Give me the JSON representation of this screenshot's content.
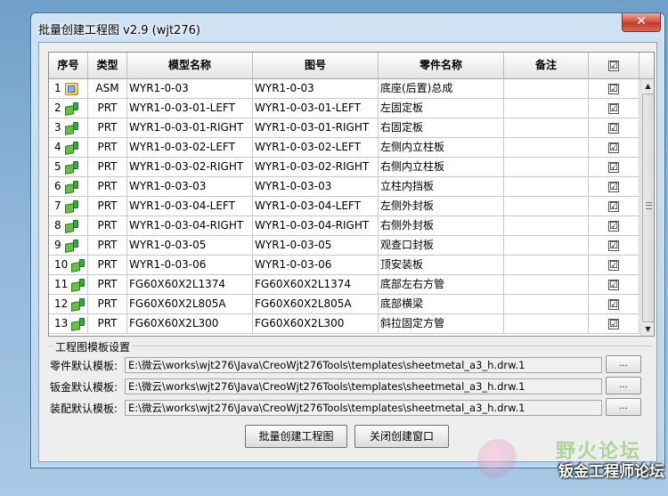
{
  "window": {
    "title": "批量创建工程图 v2.9 (wjt276)",
    "close_glyph": "✕"
  },
  "table": {
    "headers": [
      "序号",
      "类型",
      "模型名称",
      "图号",
      "零件名称",
      "备注",
      "☑"
    ],
    "rows": [
      {
        "no": "1",
        "type": "ASM",
        "icon": "assembly-icon",
        "model": "WYR1-0-03",
        "drawing": "WYR1-0-03",
        "part": "底座(后置)总成",
        "note": "",
        "checked": "☑"
      },
      {
        "no": "2",
        "type": "PRT",
        "icon": "part-icon",
        "model": "WYR1-0-03-01-LEFT",
        "drawing": "WYR1-0-03-01-LEFT",
        "part": "左固定板",
        "note": "",
        "checked": "☑"
      },
      {
        "no": "3",
        "type": "PRT",
        "icon": "part-icon",
        "model": "WYR1-0-03-01-RIGHT",
        "drawing": "WYR1-0-03-01-RIGHT",
        "part": "右固定板",
        "note": "",
        "checked": "☑"
      },
      {
        "no": "4",
        "type": "PRT",
        "icon": "part-icon",
        "model": "WYR1-0-03-02-LEFT",
        "drawing": "WYR1-0-03-02-LEFT",
        "part": "左侧内立柱板",
        "note": "",
        "checked": "☑"
      },
      {
        "no": "5",
        "type": "PRT",
        "icon": "part-icon",
        "model": "WYR1-0-03-02-RIGHT",
        "drawing": "WYR1-0-03-02-RIGHT",
        "part": "右侧内立柱板",
        "note": "",
        "checked": "☑"
      },
      {
        "no": "6",
        "type": "PRT",
        "icon": "part-icon",
        "model": "WYR1-0-03-03",
        "drawing": "WYR1-0-03-03",
        "part": "立柱内挡板",
        "note": "",
        "checked": "☑"
      },
      {
        "no": "7",
        "type": "PRT",
        "icon": "part-icon",
        "model": "WYR1-0-03-04-LEFT",
        "drawing": "WYR1-0-03-04-LEFT",
        "part": "左侧外封板",
        "note": "",
        "checked": "☑"
      },
      {
        "no": "8",
        "type": "PRT",
        "icon": "part-icon",
        "model": "WYR1-0-03-04-RIGHT",
        "drawing": "WYR1-0-03-04-RIGHT",
        "part": "右侧外封板",
        "note": "",
        "checked": "☑"
      },
      {
        "no": "9",
        "type": "PRT",
        "icon": "part-icon",
        "model": "WYR1-0-03-05",
        "drawing": "WYR1-0-03-05",
        "part": "观查口封板",
        "note": "",
        "checked": "☑"
      },
      {
        "no": "10",
        "type": "PRT",
        "icon": "part-icon",
        "model": "WYR1-0-03-06",
        "drawing": "WYR1-0-03-06",
        "part": "顶安装板",
        "note": "",
        "checked": "☑"
      },
      {
        "no": "11",
        "type": "PRT",
        "icon": "part-icon",
        "model": "FG60X60X2L1374",
        "drawing": "FG60X60X2L1374",
        "part": "底部左右方管",
        "note": "",
        "checked": "☑"
      },
      {
        "no": "12",
        "type": "PRT",
        "icon": "part-icon",
        "model": "FG60X60X2L805A",
        "drawing": "FG60X60X2L805A",
        "part": "底部横梁",
        "note": "",
        "checked": "☑"
      },
      {
        "no": "13",
        "type": "PRT",
        "icon": "part-icon",
        "model": "FG60X60X2L300",
        "drawing": "FG60X60X2L300",
        "part": "斜拉固定方管",
        "note": "",
        "checked": "☑"
      }
    ]
  },
  "templates": {
    "group_title": "工程图模板设置",
    "items": [
      {
        "label": "零件默认模板:",
        "value": "E:\\微云\\works\\wjt276\\Java\\CreoWjt276Tools\\templates\\sheetmetal_a3_h.drw.1",
        "button": "..."
      },
      {
        "label": "钣金默认模板:",
        "value": "E:\\微云\\works\\wjt276\\Java\\CreoWjt276Tools\\templates\\sheetmetal_a3_h.drw.1",
        "button": "..."
      },
      {
        "label": "装配默认模板:",
        "value": "E:\\微云\\works\\wjt276\\Java\\CreoWjt276Tools\\templates\\sheetmetal_a3_h.drw.1",
        "button": "..."
      }
    ]
  },
  "actions": {
    "create_label": "批量创建工程图",
    "close_label": "关闭创建窗口"
  },
  "watermark": {
    "top": "野火论坛",
    "bottom": "钣金工程师论坛"
  }
}
